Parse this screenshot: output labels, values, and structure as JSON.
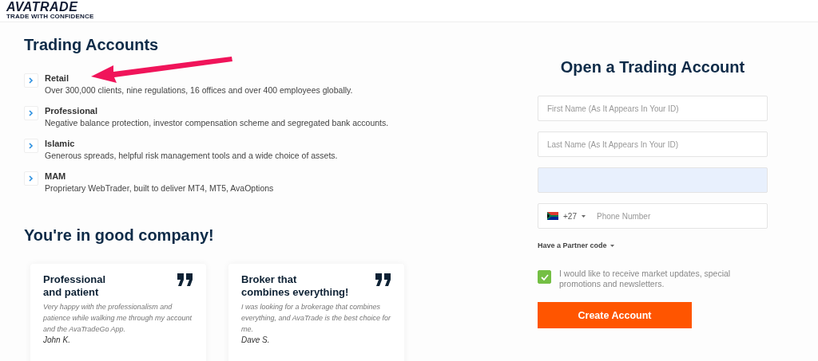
{
  "logo": {
    "name": "AVATRADE",
    "tagline": "TRADE WITH CONFIDENCE"
  },
  "accounts": {
    "title": "Trading Accounts",
    "items": [
      {
        "name": "Retail",
        "description": "Over 300,000 clients, nine regulations, 16 offices and over 400 employees globally."
      },
      {
        "name": "Professional",
        "description": "Negative balance protection, investor compensation scheme and segregated bank accounts."
      },
      {
        "name": "Islamic",
        "description": "Generous spreads, helpful risk management tools and a wide choice of assets."
      },
      {
        "name": "MAM",
        "description": "Proprietary WebTrader, built to deliver MT4, MT5, AvaOptions"
      }
    ]
  },
  "testimonials": {
    "title": "You're in good company!",
    "cards": [
      {
        "heading": "Professional\nand patient",
        "quote": "Very happy with the professionalism and patience while walking me through my account and the AvaTradeGo App.",
        "author": "John K."
      },
      {
        "heading": "Broker that\ncombines everything!",
        "quote": "I was looking for a brokerage that combines everything, and AvaTrade is the best choice for me.",
        "author": "Dave S."
      }
    ]
  },
  "form": {
    "title": "Open a Trading Account",
    "fields": [
      {
        "kind": "text",
        "placeholder": "First Name (As It Appears In Your ID)"
      },
      {
        "kind": "text",
        "placeholder": "Last Name (As It Appears In Your ID)"
      },
      {
        "kind": "autofilled"
      },
      {
        "kind": "phone",
        "code": "+27",
        "placeholder": "Phone Number"
      }
    ],
    "partner_code": {
      "label": "Have a Partner code",
      "expanded": false
    },
    "consent": {
      "label": "I would like to receive market updates, special promotions and newsletters.",
      "checked": true
    },
    "submit": "Create Account"
  }
}
